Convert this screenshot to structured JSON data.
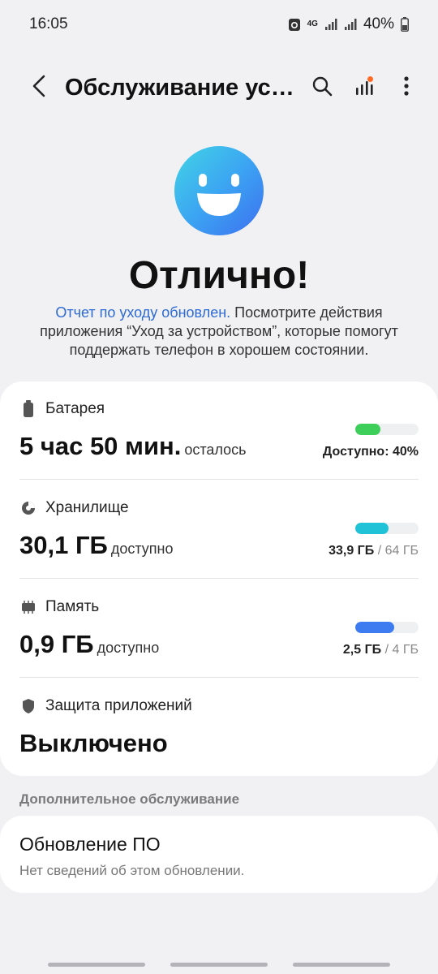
{
  "status_bar": {
    "time": "16:05",
    "network": "4G",
    "battery_percent": "40%",
    "icons": [
      "recycle-icon",
      "signal-icon",
      "signal-icon",
      "battery-icon"
    ]
  },
  "app_bar": {
    "title": "Обслуживание устройства",
    "icons": [
      "back-arrow-icon",
      "search-icon",
      "signal-bars-icon",
      "more-vertical-icon"
    ]
  },
  "hero": {
    "headline": "Отлично!",
    "summary_link": "Отчет по уходу обновлен.",
    "summary_text": " Посмотрите действия приложения “Уход за устройством”, которые помогут поддержать телефон в хорошем состоянии."
  },
  "battery": {
    "label": "Батарея",
    "value": "5 час 50 мин.",
    "unit": "осталось",
    "caption": "Доступно: 40%",
    "level": 0.4,
    "color": "#3ecf5a"
  },
  "storage": {
    "label": "Хранилище",
    "value": "30,1 ГБ",
    "unit": "доступно",
    "used": "33,9 ГБ",
    "total": "/ 64 ГБ",
    "level": 0.53,
    "color": "#1fc2d6"
  },
  "memory": {
    "label": "Память",
    "value": "0,9 ГБ",
    "unit": "доступно",
    "used": "2,5 ГБ",
    "total": "/ 4 ГБ",
    "level": 0.62,
    "color": "#3d7cf0"
  },
  "app_protection": {
    "label": "Защита приложений",
    "value": "Выключено"
  },
  "extra": {
    "section_title": "Дополнительное обслуживание",
    "update_title": "Обновление ПО",
    "update_subtitle": "Нет сведений об этом обновлении."
  }
}
